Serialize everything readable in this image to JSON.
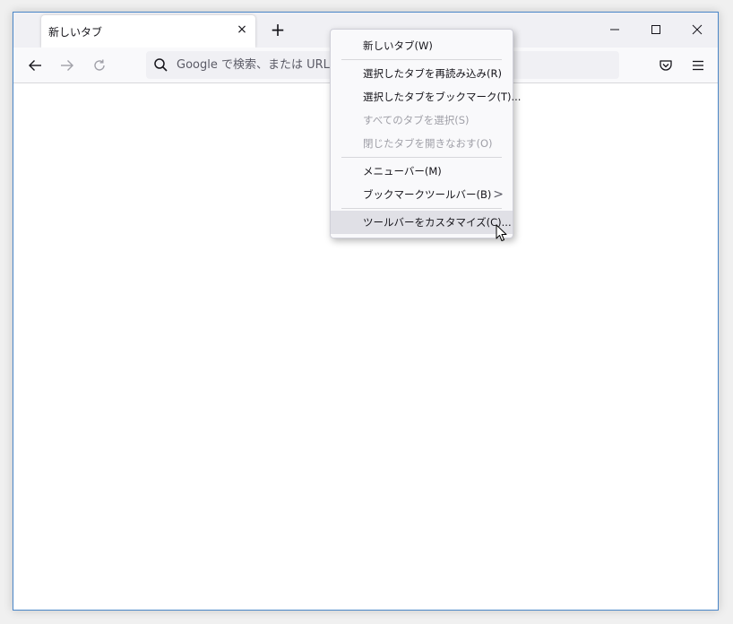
{
  "tab": {
    "title": "新しいタブ",
    "close": "×"
  },
  "new_tab": "+",
  "urlbar": {
    "placeholder": "Google で検索、または URL を入力します"
  },
  "context_menu": {
    "items": [
      {
        "label": "新しいタブ(W)"
      },
      {
        "label": "選択したタブを再読み込み(R)"
      },
      {
        "label": "選択したタブをブックマーク(T)..."
      },
      {
        "label": "すべてのタブを選択(S)"
      },
      {
        "label": "閉じたタブを開きなおす(O)"
      },
      {
        "label": "メニューバー(M)"
      },
      {
        "label": "ブックマークツールバー(B)"
      },
      {
        "label": "ツールバーをカスタマイズ(C)..."
      }
    ],
    "submenu_arrow": ">"
  },
  "colors": {
    "accent": "#4a86c8",
    "toolbar": "#f9f9fb",
    "titlebar": "#f0f0f4"
  }
}
